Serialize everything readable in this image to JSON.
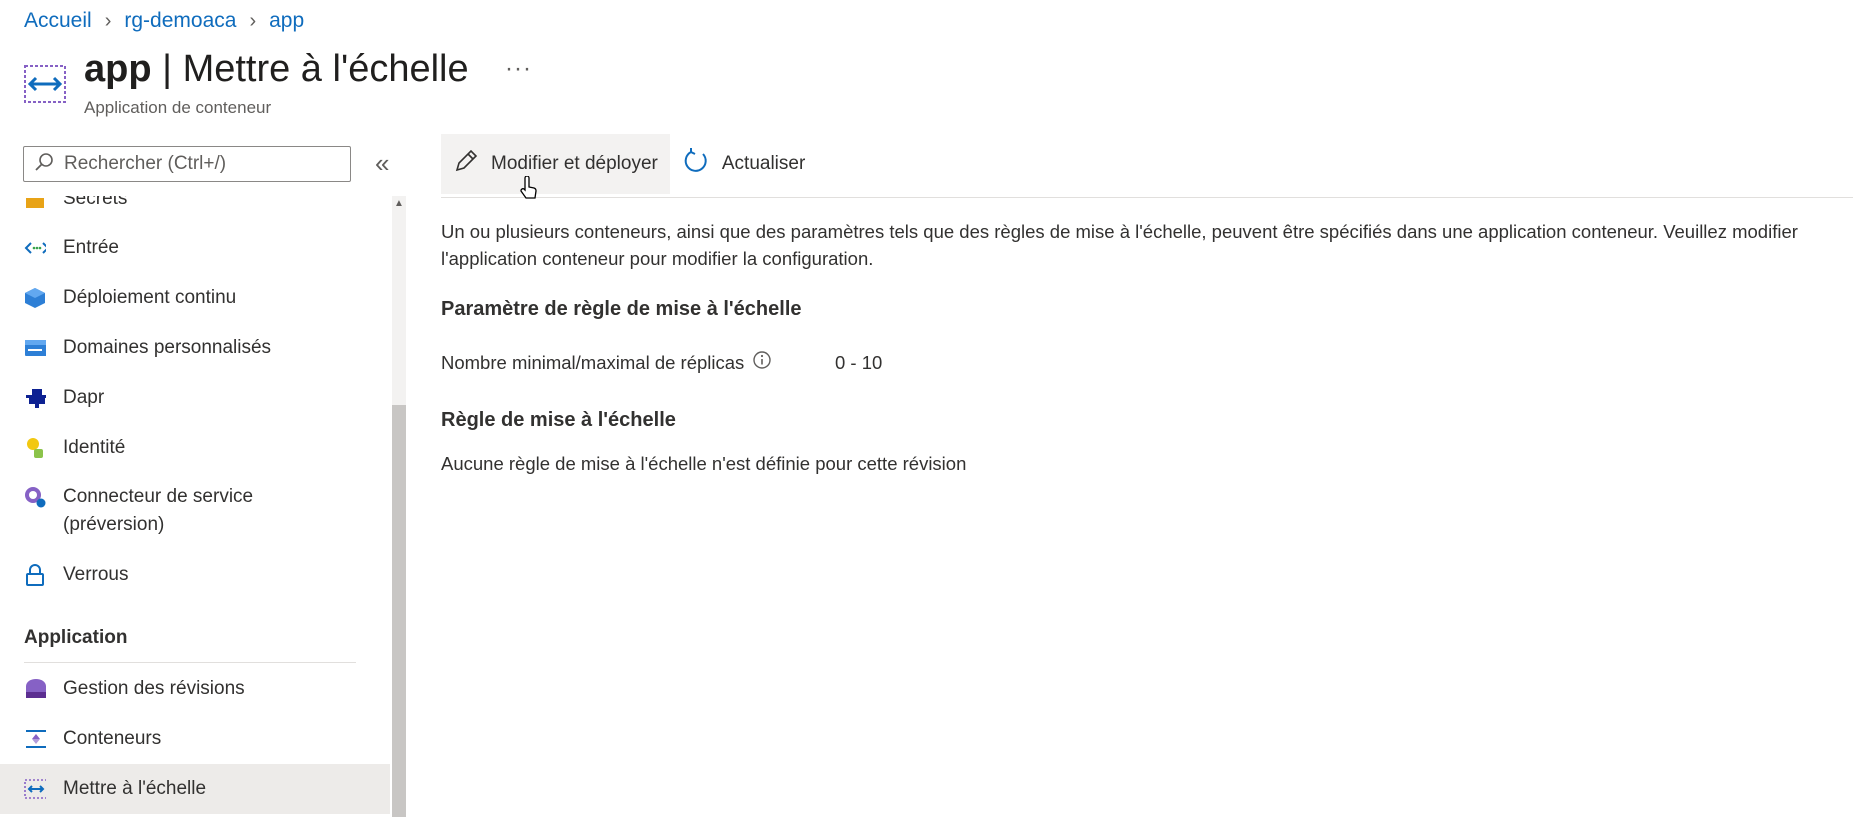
{
  "breadcrumb": [
    {
      "label": "Accueil"
    },
    {
      "label": "rg-demoaca"
    },
    {
      "label": "app"
    }
  ],
  "header": {
    "resource_name": "app",
    "title_separator": " | ",
    "page_name": "Mettre à l'échelle",
    "more_label": "···",
    "subtitle": "Application de conteneur"
  },
  "search": {
    "placeholder": "Rechercher (Ctrl+/)",
    "value": ""
  },
  "sidebar": {
    "collapse_label": "«",
    "items": [
      {
        "label": "Secrets",
        "icon": "key-icon"
      },
      {
        "label": "Entrée",
        "icon": "ingress-icon"
      },
      {
        "label": "Déploiement continu",
        "icon": "cube-icon"
      },
      {
        "label": "Domaines personnalisés",
        "icon": "domain-icon"
      },
      {
        "label": "Dapr",
        "icon": "dapr-icon"
      },
      {
        "label": "Identité",
        "icon": "identity-icon"
      },
      {
        "label": "Connecteur de service",
        "label2": "(préversion)",
        "icon": "connector-icon"
      },
      {
        "label": "Verrous",
        "icon": "lock-icon"
      }
    ],
    "section_title": "Application",
    "app_items": [
      {
        "label": "Gestion des révisions",
        "icon": "revisions-icon"
      },
      {
        "label": "Conteneurs",
        "icon": "containers-icon"
      },
      {
        "label": "Mettre à l'échelle",
        "icon": "scale-icon",
        "selected": true
      }
    ]
  },
  "toolbar": {
    "edit_deploy_label": "Modifier et déployer",
    "refresh_label": "Actualiser"
  },
  "content": {
    "description": "Un ou plusieurs conteneurs, ainsi que des paramètres tels que des règles de mise à l'échelle, peuvent être spécifiés dans une application conteneur. Veuillez modifier l'application conteneur pour modifier la configuration.",
    "scale_param_title": "Paramètre de règle de mise à l'échelle",
    "replicas_label": "Nombre minimal/maximal de réplicas",
    "replicas_value": "0 - 10",
    "scale_rule_title": "Règle de mise à l'échelle",
    "no_rule_text": "Aucune règle de mise à l'échelle n'est définie pour cette révision"
  },
  "colors": {
    "link": "#0f6cbd",
    "selected_bg": "#edebe9",
    "text": "#323130"
  }
}
